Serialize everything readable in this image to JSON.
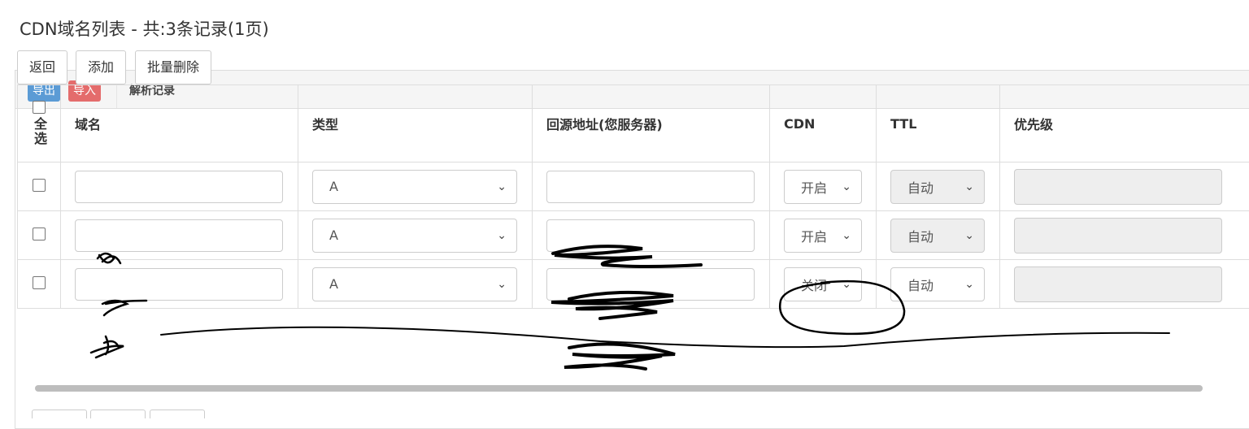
{
  "page": {
    "title": "CDN域名列表 - 共:3条记录(1页)"
  },
  "header": {
    "export_label": "导出",
    "import_label": "导入",
    "section_title": "解析记录"
  },
  "toolbar": {
    "back_label": "返回",
    "add_label": "添加",
    "batch_delete_label": "批量删除"
  },
  "table": {
    "columns": {
      "select_all": "全选",
      "domain": "域名",
      "type": "类型",
      "origin": "回源地址(您服务器)",
      "cdn": "CDN",
      "ttl": "TTL",
      "priority": "优先级"
    },
    "rows": [
      {
        "type": "A",
        "cdn": "开启",
        "ttl": "自动",
        "ttl_disabled": true
      },
      {
        "type": "A",
        "cdn": "开启",
        "ttl": "自动",
        "ttl_disabled": true
      },
      {
        "type": "A",
        "cdn": "关闭",
        "ttl": "自动",
        "ttl_disabled": false
      }
    ]
  },
  "colors": {
    "export": "#5b9bd5",
    "import": "#e46c6c",
    "annotation": "#000000"
  }
}
